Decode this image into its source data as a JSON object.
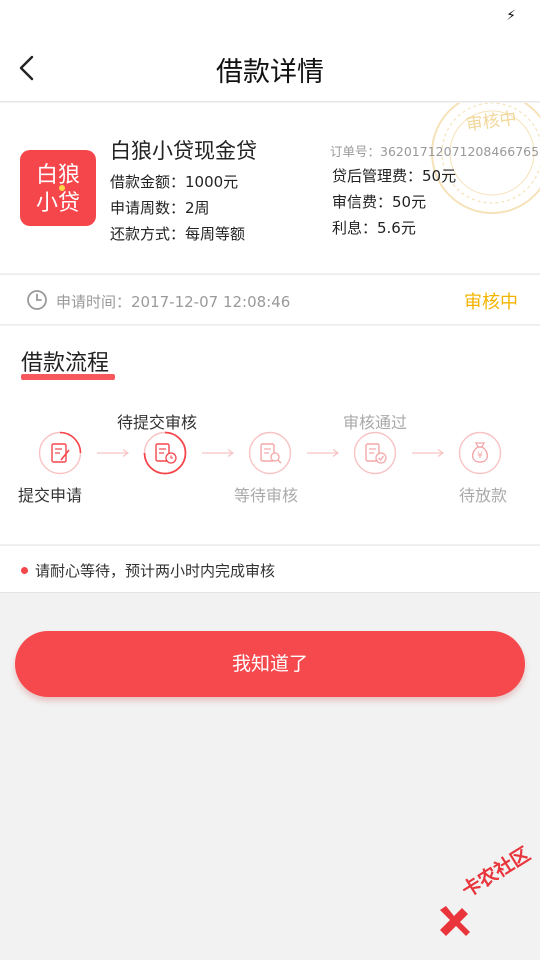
{
  "status_bar": {
    "icon": "charging-bolt-icon",
    "glyph": "⚡"
  },
  "nav": {
    "title": "借款详情",
    "back_icon": "chevron-left-icon"
  },
  "product": {
    "name": "白狼小贷现金贷",
    "logo_text": [
      "白狼",
      "小贷"
    ],
    "amount": "借款金额：1000元",
    "period": "申请周数：2周",
    "repay_method": "还款方式：每周等额"
  },
  "order": {
    "number": "订单号：36201712071208466765",
    "mgmt_fee": "贷后管理费：50元",
    "credit_fee": "审信费：50元",
    "interest": "利息：5.6元",
    "stamp_text": "审核中"
  },
  "apply": {
    "time": "申请时间：2017-12-07 12:08:46",
    "status": "审核中",
    "status_color": "#f3b400"
  },
  "flow": {
    "title": "借款流程",
    "steps": [
      {
        "label": "提交申请",
        "icon": "document-edit-icon"
      },
      {
        "label": "待提交审核",
        "icon": "document-clock-icon"
      },
      {
        "label": "等待审核",
        "icon": "document-search-icon"
      },
      {
        "label": "审核通过",
        "icon": "document-check-icon"
      },
      {
        "label": "待放款",
        "icon": "money-bag-icon"
      }
    ]
  },
  "notice": {
    "text": "请耐心等待，预计两小时内完成审核"
  },
  "button": {
    "label": "我知道了"
  },
  "watermark": {
    "text": "卡农社区"
  },
  "colors": {
    "accent": "#f5464b",
    "pending": "#f3b400",
    "muted": "#aaaaaa",
    "background": "#f2f2f2"
  }
}
